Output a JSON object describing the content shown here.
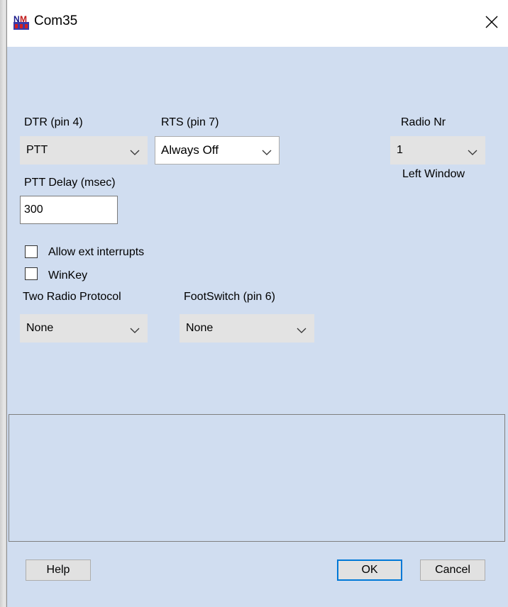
{
  "window": {
    "title": "Com35",
    "icon": "app-logo-icon",
    "close_icon": "close-icon"
  },
  "dtr": {
    "label": "DTR (pin 4)",
    "value": "PTT"
  },
  "rts": {
    "label": "RTS (pin 7)",
    "value": "Always Off"
  },
  "radio_nr": {
    "label": "Radio Nr",
    "value": "1",
    "caption": "Left Window"
  },
  "ptt_delay": {
    "label": "PTT Delay  (msec)",
    "value": "300"
  },
  "checkboxes": [
    {
      "label": "Allow ext interrupts",
      "checked": false
    },
    {
      "label": "WinKey",
      "checked": false
    }
  ],
  "two_radio_protocol": {
    "label": "Two Radio Protocol",
    "value": "None"
  },
  "footswitch": {
    "label": "FootSwitch (pin 6)",
    "value": "None"
  },
  "buttons": {
    "help": "Help",
    "ok": "OK",
    "cancel": "Cancel"
  },
  "colors": {
    "dialog_bg": "#d0ddf0",
    "default_button_border": "#0078d7"
  }
}
